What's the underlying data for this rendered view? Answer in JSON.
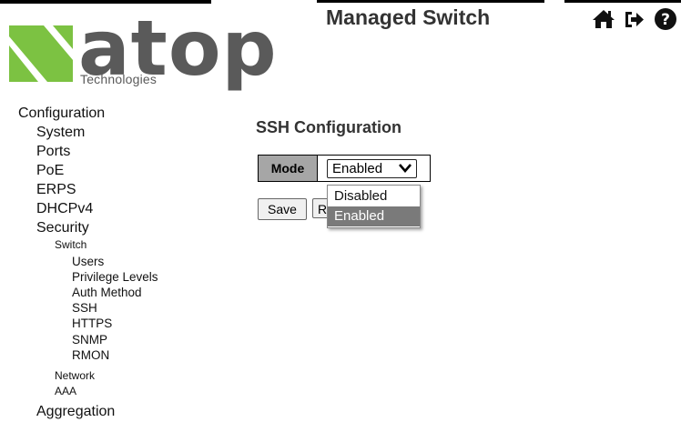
{
  "logo": {
    "wordmark": "atop",
    "tagline": "Technologies"
  },
  "header": {
    "title": "Managed Switch",
    "icons": [
      "home-icon",
      "logout-icon",
      "help-icon"
    ]
  },
  "nav": {
    "configuration": "Configuration",
    "system": "System",
    "ports": "Ports",
    "poe": "PoE",
    "erps": "ERPS",
    "dhcpv4": "DHCPv4",
    "security": "Security",
    "switch": "Switch",
    "users": "Users",
    "privilege_levels": "Privilege Levels",
    "auth_method": "Auth Method",
    "ssh": "SSH",
    "https": "HTTPS",
    "snmp": "SNMP",
    "rmon": "RMON",
    "network": "Network",
    "aaa": "AAA",
    "aggregation": "Aggregation"
  },
  "main": {
    "title": "SSH Configuration",
    "mode_label": "Mode",
    "mode_value": "Enabled",
    "mode_options": [
      "Disabled",
      "Enabled"
    ],
    "save_label": "Save",
    "reset_label": "R"
  },
  "colors": {
    "logo_green": "#7cc242",
    "logo_gray": "#5a5a5a",
    "label_bg": "#a6a6a6",
    "highlight": "#7a7a7a"
  }
}
